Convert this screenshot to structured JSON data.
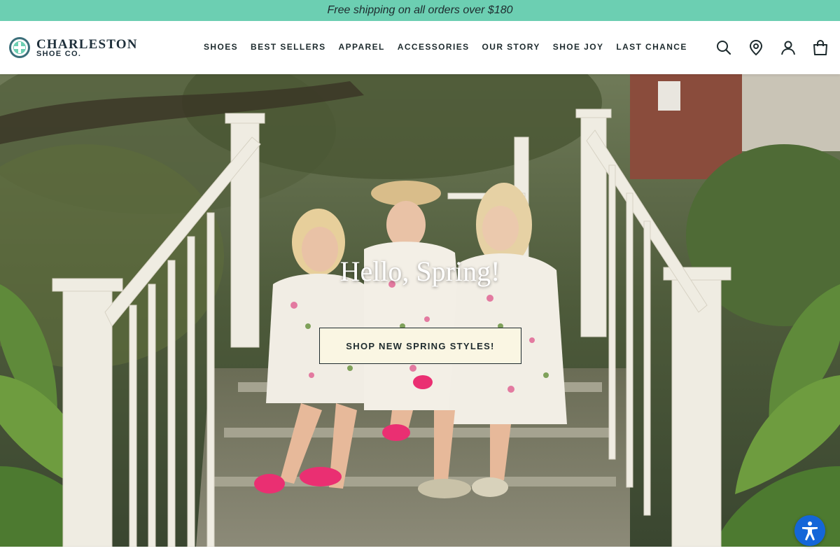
{
  "announcement": {
    "text": "Free shipping on all orders over $180"
  },
  "brand": {
    "name": "CHARLESTON",
    "sub": "SHOE CO."
  },
  "nav": {
    "items": [
      "SHOES",
      "BEST SELLERS",
      "APPAREL",
      "ACCESSORIES",
      "OUR STORY",
      "SHOE JOY",
      "LAST CHANCE"
    ]
  },
  "header_icons": [
    "search-icon",
    "location-pin-icon",
    "account-icon",
    "shopping-bag-icon"
  ],
  "hero": {
    "title": "Hello, Spring!",
    "button_label": "SHOP NEW SPRING STYLES!"
  },
  "colors": {
    "announcement_bg": "#6ccfb2",
    "button_bg": "#faf6e3",
    "accessibility_blue": "#1466d8"
  }
}
